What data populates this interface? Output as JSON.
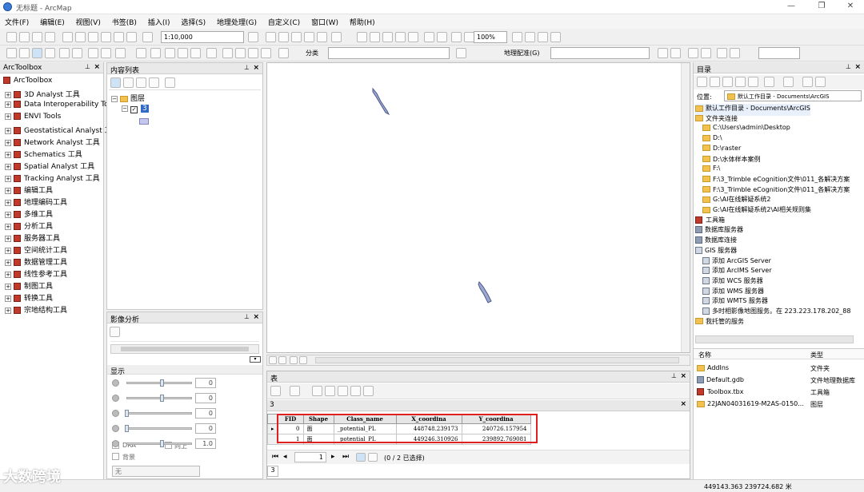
{
  "window": {
    "title": "无标题 - ArcMap",
    "minimize": "—",
    "maximize": "❐",
    "close": "✕"
  },
  "menu": [
    "文件(F)",
    "编辑(E)",
    "视图(V)",
    "书签(B)",
    "插入(I)",
    "选择(S)",
    "地理处理(G)",
    "自定义(C)",
    "窗口(W)",
    "帮助(H)"
  ],
  "toolbar": {
    "scale": "1:10,000",
    "zoom_pct": "100%",
    "classify_label": "分类",
    "georef_label": "地理配准(G)"
  },
  "arctoolbox": {
    "title": "ArcToolbox",
    "root": "ArcToolbox",
    "items": [
      "3D Analyst 工具",
      "Data Interoperability Tc",
      "ENVI Tools",
      "Geostatistical Analyst 工",
      "Network Analyst 工具",
      "Schematics 工具",
      "Spatial Analyst 工具",
      "Tracking Analyst 工具",
      "编辑工具",
      "地理编码工具",
      "多维工具",
      "分析工具",
      "服务器工具",
      "空间统计工具",
      "数据管理工具",
      "线性参考工具",
      "制图工具",
      "转换工具",
      "宗地结构工具"
    ]
  },
  "toc": {
    "title": "内容列表",
    "layers_label": "图层",
    "layer_name": "3"
  },
  "image_analysis": {
    "title": "影像分析",
    "display_label": "显示",
    "values": [
      "0",
      "0",
      "0",
      "0",
      "1.0"
    ],
    "dra_label": "DRA",
    "up_label": "向上",
    "background_label": "背景",
    "none_label": "无"
  },
  "catalog": {
    "title": "目录",
    "location_label": "位置:",
    "location_value": "默认工作目录 - Documents\\ArcGIS",
    "items": [
      {
        "label": "默认工作目录 - Documents\\ArcGIS",
        "indent": 0,
        "icon": "folder"
      },
      {
        "label": "文件夹连接",
        "indent": 0,
        "icon": "folder"
      },
      {
        "label": "C:\\Users\\admin\\Desktop",
        "indent": 1,
        "icon": "folder"
      },
      {
        "label": "D:\\",
        "indent": 1,
        "icon": "folder"
      },
      {
        "label": "D:\\raster",
        "indent": 1,
        "icon": "folder"
      },
      {
        "label": "D:\\水体样本案例",
        "indent": 1,
        "icon": "folder"
      },
      {
        "label": "F:\\",
        "indent": 1,
        "icon": "folder"
      },
      {
        "label": "F:\\3_Trimble eCognition文件\\011_各解决方案",
        "indent": 1,
        "icon": "folder"
      },
      {
        "label": "F:\\3_Trimble eCognition文件\\011_各解决方案",
        "indent": 1,
        "icon": "folder"
      },
      {
        "label": "G:\\AI在线解疑系统2",
        "indent": 1,
        "icon": "folder"
      },
      {
        "label": "G:\\AI在线解疑系统2\\AI相关规则集",
        "indent": 1,
        "icon": "folder"
      },
      {
        "label": "工具箱",
        "indent": 0,
        "icon": "toolbox"
      },
      {
        "label": "数据库服务器",
        "indent": 0,
        "icon": "db"
      },
      {
        "label": "数据库连接",
        "indent": 0,
        "icon": "db"
      },
      {
        "label": "GIS 服务器",
        "indent": 0,
        "icon": "server"
      },
      {
        "label": "添加 ArcGIS Server",
        "indent": 1,
        "icon": "server"
      },
      {
        "label": "添加 ArcIMS Server",
        "indent": 1,
        "icon": "server"
      },
      {
        "label": "添加 WCS 服务器",
        "indent": 1,
        "icon": "server"
      },
      {
        "label": "添加 WMS 服务器",
        "indent": 1,
        "icon": "server"
      },
      {
        "label": "添加 WMTS 服务器",
        "indent": 1,
        "icon": "server"
      },
      {
        "label": "多时相影像地图服务。在 223.223.178.202_88",
        "indent": 1,
        "icon": "server"
      },
      {
        "label": "我托管的服务",
        "indent": 0,
        "icon": "folder"
      }
    ],
    "list_headers": {
      "name": "名称",
      "type": "类型"
    },
    "list_rows": [
      {
        "name": "AddIns",
        "type": "文件夹",
        "icon": "folder"
      },
      {
        "name": "Default.gdb",
        "type": "文件地理数据库",
        "icon": "db"
      },
      {
        "name": "Toolbox.tbx",
        "type": "工具箱",
        "icon": "toolbox"
      },
      {
        "name": "22JAN04031619-M2AS-0150...",
        "type": "图层",
        "icon": "layer"
      }
    ]
  },
  "table_window": {
    "title": "表",
    "tab_name": "3",
    "columns": [
      "FID",
      "Shape",
      "Class_name",
      "X_coordina",
      "Y_coordina"
    ],
    "rows": [
      [
        "0",
        "面",
        "_potential_PL",
        "448748.239173",
        "240726.157954"
      ],
      [
        "1",
        "面",
        "_potential_PL",
        "449246.310926",
        "239892.769081"
      ]
    ],
    "page_current": "1",
    "selection_text": "(0 / 2 已选择)",
    "bottom_tab": "3"
  },
  "status": {
    "coords": "449143.363  239724.682 米"
  },
  "watermark": "大数跨境",
  "colors": {
    "highlight_red": "#e02020",
    "shape_fill": "#9aa7d1"
  }
}
